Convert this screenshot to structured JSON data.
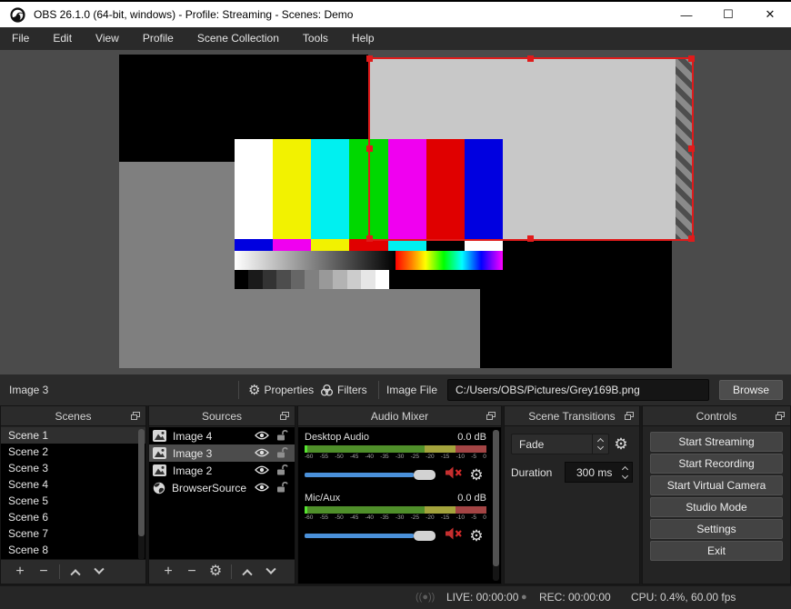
{
  "window": {
    "title": "OBS 26.1.0 (64-bit, windows) - Profile: Streaming - Scenes: Demo",
    "controls": {
      "minimize": "—",
      "maximize": "☐",
      "close": "✕"
    }
  },
  "menu": {
    "items": [
      "File",
      "Edit",
      "View",
      "Profile",
      "Scene Collection",
      "Tools",
      "Help"
    ]
  },
  "preview": {
    "background": "#4b4b4b",
    "selection_color": "#e01b1b",
    "canvas_grey": "#7f7f7f",
    "selected_image_grey": "#c8c8c8",
    "bars_row1_colors": [
      "#ffffff",
      "#f2f200",
      "#00f0f0",
      "#00d800",
      "#f000f0",
      "#e00000",
      "#0000e0"
    ],
    "bars_row2_colors": [
      "#0000e0",
      "#f000f0",
      "#f2f200",
      "#e00000",
      "#00f0f0",
      "#000000",
      "#ffffff"
    ]
  },
  "toolbar": {
    "source_label": "Image 3",
    "properties_label": "Properties",
    "filters_label": "Filters",
    "image_file_label": "Image File",
    "image_file_value": "C:/Users/OBS/Pictures/Grey169B.png",
    "browse_label": "Browse"
  },
  "docks": {
    "scenes": {
      "title": "Scenes",
      "items": [
        "Scene 1",
        "Scene 2",
        "Scene 3",
        "Scene 4",
        "Scene 5",
        "Scene 6",
        "Scene 7",
        "Scene 8"
      ],
      "selected_index": 0
    },
    "sources": {
      "title": "Sources",
      "items": [
        {
          "name": "Image 4",
          "type": "image",
          "selected": false
        },
        {
          "name": "Image 3",
          "type": "image",
          "selected": true
        },
        {
          "name": "Image 2",
          "type": "image",
          "selected": false
        },
        {
          "name": "BrowserSource",
          "type": "browser",
          "selected": false
        }
      ]
    },
    "audio_mixer": {
      "title": "Audio Mixer",
      "channels": [
        {
          "name": "Desktop Audio",
          "level": "0.0 dB",
          "muted": true
        },
        {
          "name": "Mic/Aux",
          "level": "0.0 dB",
          "muted": true
        }
      ],
      "ticks": [
        "-60",
        "-55",
        "-50",
        "-45",
        "-40",
        "-35",
        "-30",
        "-25",
        "-20",
        "-15",
        "-10",
        "-5",
        "0"
      ],
      "meter_green": "#4f8f2a",
      "meter_yellow": "#a3a33c",
      "meter_red": "#a34444",
      "slider_blue": "#4a90d9",
      "mute_red": "#c52f2f"
    },
    "transitions": {
      "title": "Scene Transitions",
      "transition": "Fade",
      "duration_label": "Duration",
      "duration_value": "300 ms"
    },
    "controls": {
      "title": "Controls",
      "buttons": [
        "Start Streaming",
        "Start Recording",
        "Start Virtual Camera",
        "Studio Mode",
        "Settings",
        "Exit"
      ]
    }
  },
  "statusbar": {
    "live": "LIVE: 00:00:00",
    "rec": "REC: 00:00:00",
    "cpu": "CPU: 0.4%, 60.00 fps"
  }
}
